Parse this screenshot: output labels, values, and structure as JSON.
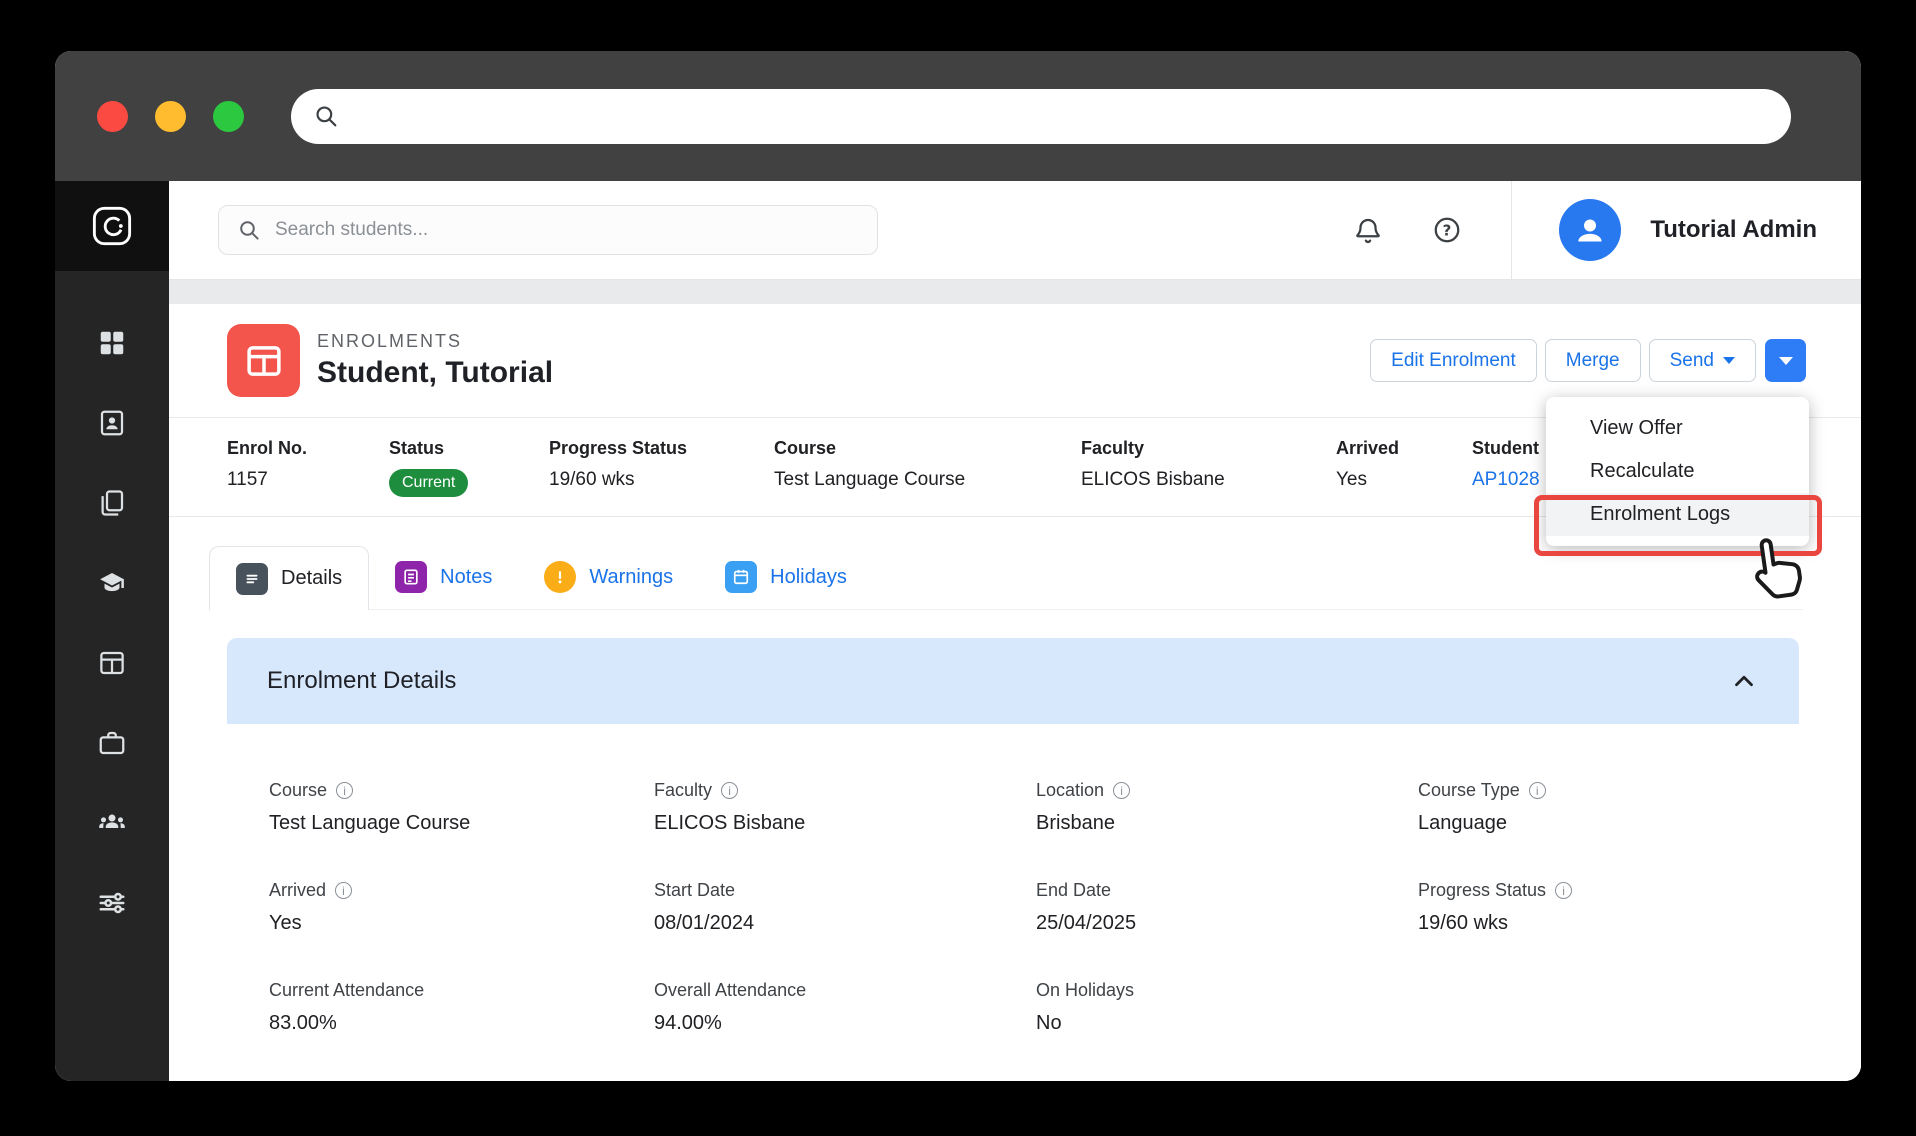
{
  "titlebar": {
    "address_value": ""
  },
  "sidebar": {
    "icons": [
      "app-logo",
      "dashboard",
      "students",
      "documents",
      "courses",
      "enrolments",
      "work",
      "agents",
      "settings"
    ]
  },
  "topnav": {
    "search_placeholder": "Search students...",
    "user_name": "Tutorial Admin"
  },
  "header": {
    "eyebrow": "ENROLMENTS",
    "title": "Student, Tutorial",
    "edit_button": "Edit Enrolment",
    "merge_button": "Merge",
    "send_button": "Send"
  },
  "dropdown": {
    "items": [
      "View Offer",
      "Recalculate",
      "Enrolment Logs"
    ]
  },
  "summary": {
    "fields": [
      {
        "label": "Enrol No.",
        "value": "1157"
      },
      {
        "label": "Status",
        "value": "Current"
      },
      {
        "label": "Progress Status",
        "value": "19/60 wks"
      },
      {
        "label": "Course",
        "value": "Test Language Course"
      },
      {
        "label": "Faculty",
        "value": "ELICOS Bisbane"
      },
      {
        "label": "Arrived",
        "value": "Yes"
      },
      {
        "label": "Student",
        "value": "AP1028"
      }
    ]
  },
  "tabs": [
    {
      "label": "Details"
    },
    {
      "label": "Notes"
    },
    {
      "label": "Warnings"
    },
    {
      "label": "Holidays"
    }
  ],
  "panel": {
    "title": "Enrolment Details",
    "fields": [
      {
        "label": "Course",
        "value": "Test Language Course"
      },
      {
        "label": "Faculty",
        "value": "ELICOS Bisbane"
      },
      {
        "label": "Location",
        "value": "Brisbane"
      },
      {
        "label": "Course Type",
        "value": "Language"
      },
      {
        "label": "Arrived",
        "value": "Yes"
      },
      {
        "label": "Start Date",
        "value": "08/01/2024"
      },
      {
        "label": "End Date",
        "value": "25/04/2025"
      },
      {
        "label": "Progress Status",
        "value": "19/60 wks"
      },
      {
        "label": "Current Attendance",
        "value": "83.00%"
      },
      {
        "label": "Overall Attendance",
        "value": "94.00%"
      },
      {
        "label": "On Holidays",
        "value": "No"
      }
    ]
  },
  "colors": {
    "accent_blue": "#1a73e8",
    "split_button_blue": "#2e7df6",
    "badge_green": "#1e8e3e",
    "annotation_red": "#e8463e",
    "module_red": "#f3544b",
    "notes_purple": "#8e24aa",
    "warnings_amber": "#fbad18",
    "holidays_blue": "#3aa0f4",
    "panel_header_blue": "#d7e7fc"
  }
}
